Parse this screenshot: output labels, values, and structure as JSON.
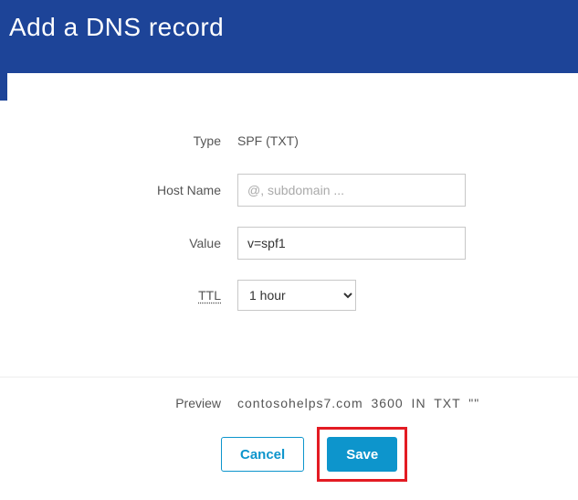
{
  "header": {
    "title": "Add a DNS record"
  },
  "form": {
    "type_label": "Type",
    "type_value": "SPF (TXT)",
    "hostname_label": "Host Name",
    "hostname_placeholder": "@, subdomain ...",
    "hostname_value": "",
    "value_label": "Value",
    "value_value": "v=spf1",
    "ttl_label": "TTL",
    "ttl_selected": "1 hour"
  },
  "preview": {
    "label": "Preview",
    "value": "contosohelps7.com  3600  IN  TXT  \"\""
  },
  "buttons": {
    "cancel": "Cancel",
    "save": "Save"
  }
}
